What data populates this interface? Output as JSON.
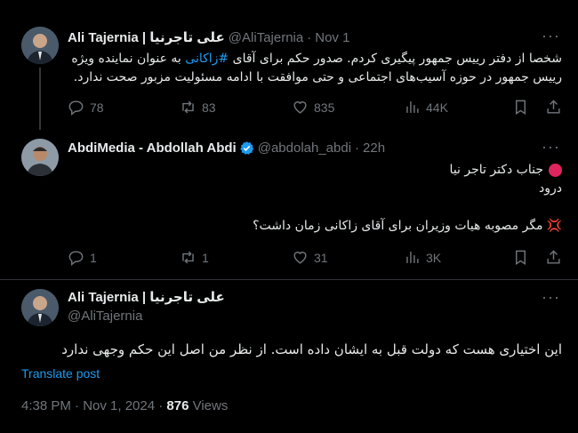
{
  "posts": [
    {
      "name": "Ali Tajernia | علی تاجرنیا",
      "handle": "@AliTajernia",
      "dot": "·",
      "time": "Nov 1",
      "more": "···",
      "text_pre": "شخصا از دفتر رییس جمهور پیگیری کردم. صدور حکم برای آقای ",
      "hashtag": "#زاکانی",
      "text_post": " به عنوان نماینده ویژه رییس جمهور در حوزه آسیب‌های اجتماعی و حتی موافقت با ادامه مسئولیت مزبور صحت ندارد.",
      "replies": "78",
      "reposts": "83",
      "likes": "835",
      "views": "44K"
    },
    {
      "name": "AbdiMedia - Abdollah Abdi",
      "handle": "@abdolah_abdi",
      "dot": "·",
      "time": "22h",
      "more": "···",
      "line1": "جناب دکتر تاجر نیا",
      "line2": "درود",
      "line3": "مگر مصوبه هیات وزیران برای آقای زاکانی زمان داشت؟",
      "replies": "1",
      "reposts": "1",
      "likes": "31",
      "views": "3K"
    },
    {
      "name": "Ali Tajernia | علی تاجرنیا",
      "handle": "@AliTajernia",
      "more": "···",
      "text": "این اختیاری هست که دولت قبل به ایشان داده است. از نظر من اصل این حکم وجهی ندارد",
      "translate": "Translate post",
      "timestamp": "4:38 PM · Nov 1, 2024 · ",
      "views_count": "876",
      "views_label": " Views"
    }
  ],
  "icons": {
    "reply": "reply-icon",
    "repost": "repost-icon",
    "like": "like-icon",
    "views": "views-icon",
    "bookmark": "bookmark-icon",
    "share": "share-icon",
    "verified": "verified-badge-icon"
  },
  "colors": {
    "accent": "#1d9bf0",
    "muted": "#71767b",
    "background": "#000000"
  }
}
